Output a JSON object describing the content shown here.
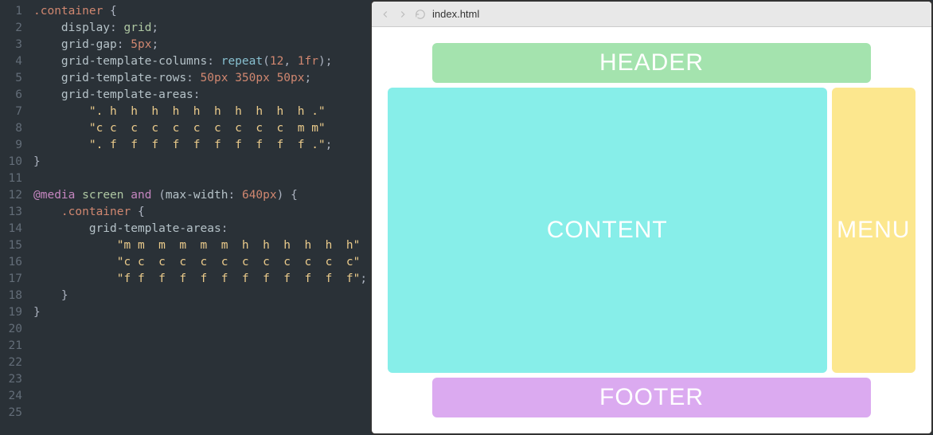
{
  "editor": {
    "lines": [
      {
        "n": 1,
        "html": "<span class='c-sel'>.container</span> <span class='c-punc'>{</span>"
      },
      {
        "n": 2,
        "html": "    <span class='c-prop'>display</span><span class='c-punc'>:</span> <span class='c-val'>grid</span><span class='c-punc'>;</span>"
      },
      {
        "n": 3,
        "html": "    <span class='c-prop'>grid-gap</span><span class='c-punc'>:</span> <span class='c-num'>5px</span><span class='c-punc'>;</span>"
      },
      {
        "n": 4,
        "html": "    <span class='c-prop'>grid-template-columns</span><span class='c-punc'>:</span> <span class='c-fn'>repeat</span><span class='c-punc'>(</span><span class='c-num'>12</span><span class='c-punc'>,</span> <span class='c-num'>1fr</span><span class='c-punc'>);</span>"
      },
      {
        "n": 5,
        "html": "    <span class='c-prop'>grid-template-rows</span><span class='c-punc'>:</span> <span class='c-num'>50px</span> <span class='c-num'>350px</span> <span class='c-num'>50px</span><span class='c-punc'>;</span>"
      },
      {
        "n": 6,
        "html": "    <span class='c-prop'>grid-template-areas</span><span class='c-punc'>:</span>"
      },
      {
        "n": 7,
        "html": "        <span class='c-str'>\". h  h  h  h  h  h  h  h  h  h .\"</span>"
      },
      {
        "n": 8,
        "html": "        <span class='c-str'>\"c c  c  c  c  c  c  c  c  c  m m\"</span>"
      },
      {
        "n": 9,
        "html": "        <span class='c-str'>\". f  f  f  f  f  f  f  f  f  f .\"</span><span class='c-punc'>;</span>"
      },
      {
        "n": 10,
        "html": "<span class='c-punc'>}</span>"
      },
      {
        "n": 11,
        "html": ""
      },
      {
        "n": 12,
        "html": "<span class='c-kw'>@media</span> <span class='c-val'>screen</span> <span class='c-kw'>and</span> <span class='c-punc'>(</span><span class='c-prop'>max-width</span><span class='c-punc'>:</span> <span class='c-num'>640px</span><span class='c-punc'>)</span> <span class='c-punc'>{</span>"
      },
      {
        "n": 13,
        "html": "    <span class='c-sel'>.container</span> <span class='c-punc'>{</span>"
      },
      {
        "n": 14,
        "html": "        <span class='c-prop'>grid-template-areas</span><span class='c-punc'>:</span>"
      },
      {
        "n": 15,
        "html": "            <span class='c-str'>\"m m  m  m  m  m  h  h  h  h  h  h\"</span>"
      },
      {
        "n": 16,
        "html": "            <span class='c-str'>\"c c  c  c  c  c  c  c  c  c  c  c\"</span>"
      },
      {
        "n": 17,
        "html": "            <span class='c-str'>\"f f  f  f  f  f  f  f  f  f  f  f\"</span><span class='c-punc'>;</span>"
      },
      {
        "n": 18,
        "html": "    <span class='c-punc'>}</span>"
      },
      {
        "n": 19,
        "html": "<span class='c-punc'>}</span>"
      },
      {
        "n": 20,
        "html": ""
      },
      {
        "n": 21,
        "html": ""
      },
      {
        "n": 22,
        "html": ""
      },
      {
        "n": 23,
        "html": ""
      },
      {
        "n": 24,
        "html": ""
      },
      {
        "n": 25,
        "html": ""
      }
    ]
  },
  "toolbar": {
    "filename": "index.html"
  },
  "layout": {
    "header_label": "HEADER",
    "content_label": "CONTENT",
    "menu_label": "MENU",
    "footer_label": "FOOTER"
  }
}
